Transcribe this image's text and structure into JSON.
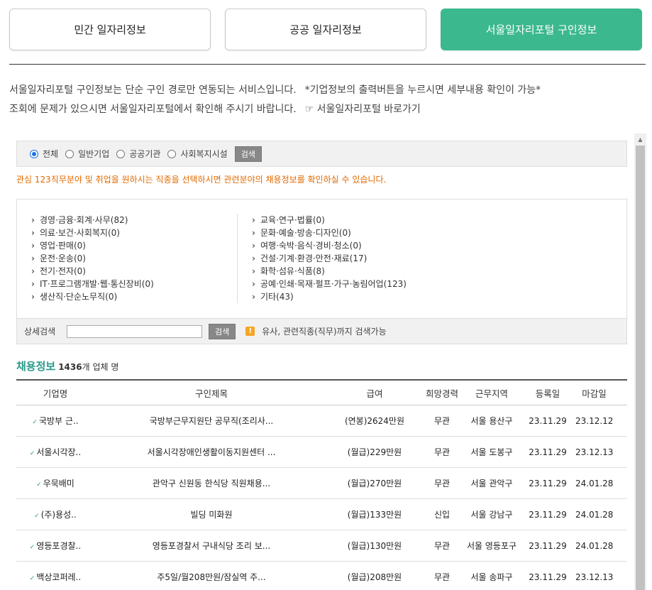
{
  "tabs": [
    {
      "label": "민간 일자리정보",
      "active": false
    },
    {
      "label": "공공 일자리정보",
      "active": false
    },
    {
      "label": "서울일자리포털 구인정보",
      "active": true
    }
  ],
  "info": {
    "line1_a": "서울일자리포털 구인정보는 단순 구인 경로만 연동되는 서비스입니다.",
    "line1_b": "*기업정보의 출력버튼을 누르시면 세부내용 확인이 가능*",
    "line2_a": "조회에 문제가 있으시면 서울일자리포털에서 확인해 주시기 바랍니다.",
    "line2_b": "☞ 서울일자리포털 바로가기"
  },
  "filter": {
    "options": [
      "전체",
      "일반기업",
      "공공기관",
      "사회복지시설"
    ],
    "selected": "전체",
    "search_label": "검색"
  },
  "notice": "관심 123직무분야 및 취업을 원하시는 직종을 선택하시면 관련분야의 채용정보를 확인하실 수 있습니다.",
  "categories": {
    "left": [
      "경영·금융·회계·사무(82)",
      "의료·보건·사회복지(0)",
      "영업·판매(0)",
      "운전·운송(0)",
      "전기·전자(0)",
      "IT·프로그램개발·웹·통신장비(0)",
      "생산직·단순노무직(0)"
    ],
    "right": [
      "교육·연구·법률(0)",
      "문화·예술·방송·디자인(0)",
      "여행·숙박·음식·경비·청소(0)",
      "건설·기계·환경·안전·재료(17)",
      "화학·섬유·식품(8)",
      "공예·인쇄·목재·펄프·가구·농림어업(123)",
      "기타(43)"
    ]
  },
  "detail_search": {
    "label": "상세검색",
    "input_value": "",
    "button": "검색",
    "hint_icon": "!",
    "hint": "유사, 관련직종(직무)까지 검색가능"
  },
  "listing": {
    "title": "채용정보",
    "count_num": "1436",
    "count_suffix": "개 업체 명",
    "columns": [
      "기업명",
      "구인제목",
      "급여",
      "희망경력",
      "근무지역",
      "등록일",
      "마감일"
    ],
    "rows": [
      {
        "company": "국방부 근..",
        "title": "국방부근무지원단 공무직(조리사...",
        "pay": "(연봉)2624만원",
        "career": "무관",
        "region": "서울 용산구",
        "reg": "23.11.29",
        "due": "23.12.12"
      },
      {
        "company": "서울시각장..",
        "title": "서울시각장애인생활이동지원센터 ...",
        "pay": "(월급)229만원",
        "career": "무관",
        "region": "서울 도봉구",
        "reg": "23.11.29",
        "due": "23.12.13"
      },
      {
        "company": "우묵배미",
        "title": "관악구 신원동 한식당 직원채용...",
        "pay": "(월급)270만원",
        "career": "무관",
        "region": "서울 관악구",
        "reg": "23.11.29",
        "due": "24.01.28"
      },
      {
        "company": "(주)용성..",
        "title": "빌딩 미화원",
        "pay": "(월급)133만원",
        "career": "신입",
        "region": "서울 강남구",
        "reg": "23.11.29",
        "due": "24.01.28"
      },
      {
        "company": "영등포경찰..",
        "title": "영등포경찰서 구내식당 조리 보...",
        "pay": "(월급)130만원",
        "career": "무관",
        "region": "서울 영등포구",
        "reg": "23.11.29",
        "due": "24.01.28"
      },
      {
        "company": "백상코퍼레..",
        "title": "주5일/월208만원/잠실역 주...",
        "pay": "(월급)208만원",
        "career": "무관",
        "region": "서울 송파구",
        "reg": "23.11.29",
        "due": "23.12.13"
      }
    ]
  }
}
